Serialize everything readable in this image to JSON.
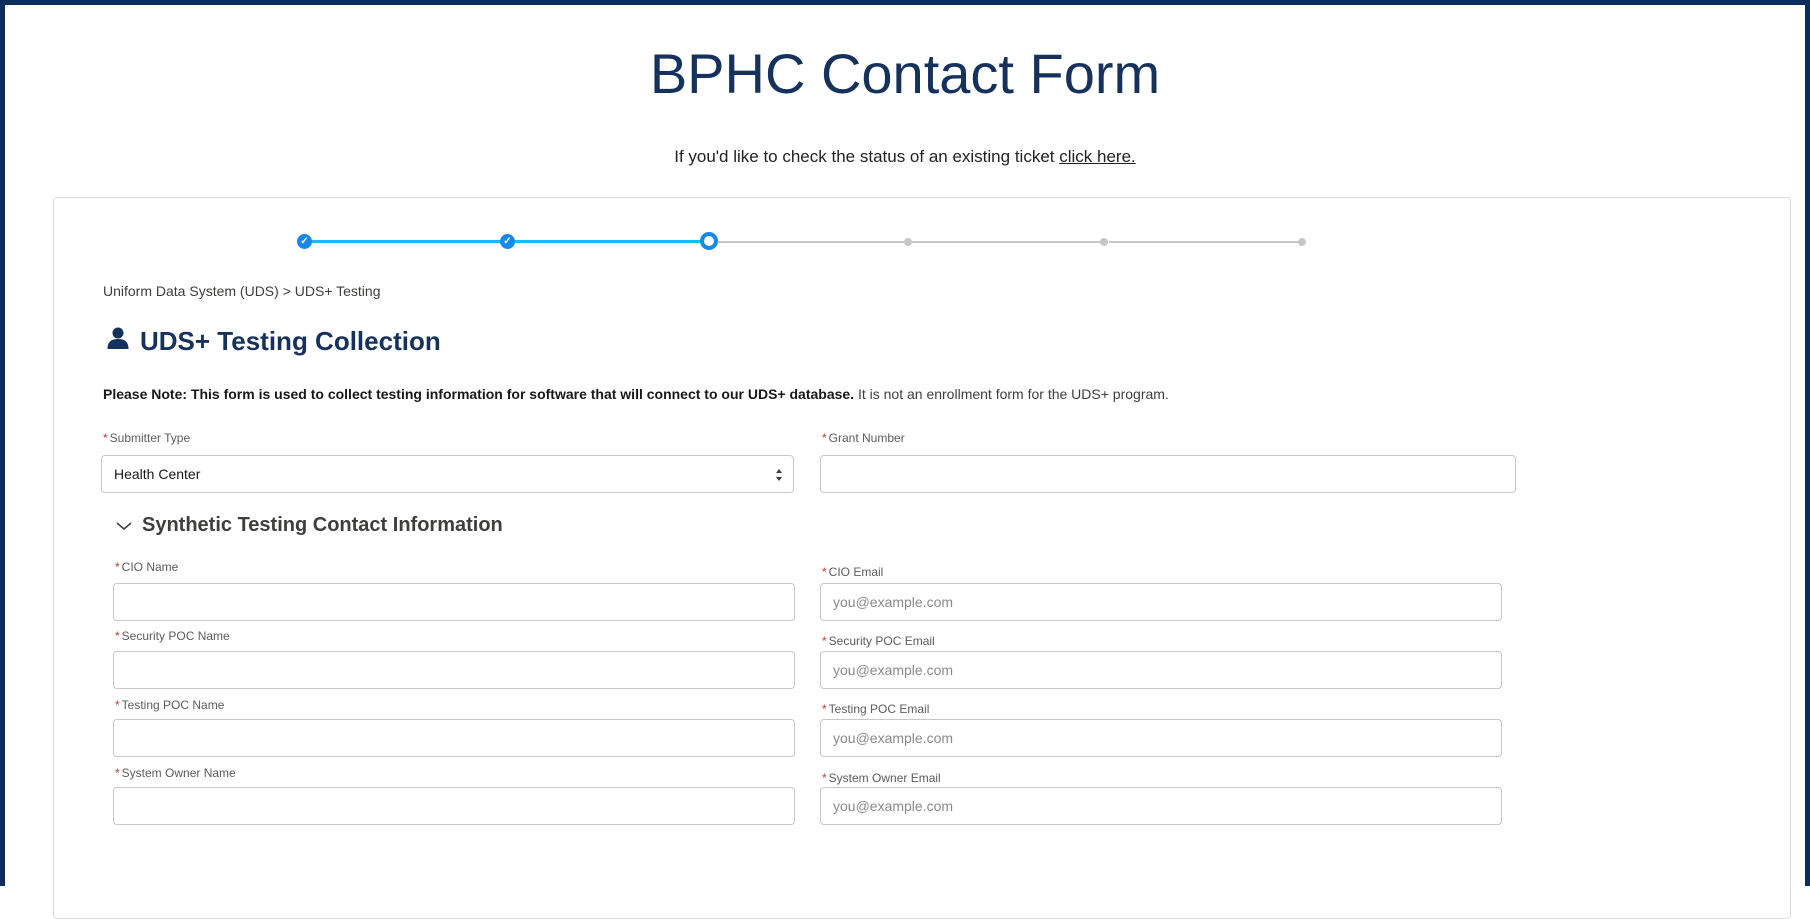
{
  "header": {
    "title": "BPHC Contact Form",
    "status_text": "If you'd like to check the status of an existing ticket",
    "status_link": "click here."
  },
  "progress": {
    "total_steps": 6,
    "completed_steps": 2,
    "current_step": 3
  },
  "breadcrumb": "Uniform Data System (UDS) > UDS+ Testing",
  "section": {
    "title": "UDS+ Testing Collection",
    "icon": "user-icon"
  },
  "note": {
    "bold": "Please Note: This form is used to collect testing information for software that will connect to our UDS+ database.",
    "rest": " It is not an enrollment form for the UDS+ program."
  },
  "fields": {
    "submitter_type": {
      "label": "Submitter Type",
      "value": "Health Center"
    },
    "grant_number": {
      "label": "Grant Number",
      "value": ""
    }
  },
  "group": {
    "title": "Synthetic Testing Contact Information",
    "icon": "chevron-down-icon"
  },
  "contacts": {
    "cio_name": {
      "label": "CIO Name",
      "value": ""
    },
    "cio_email": {
      "label": "CIO Email",
      "placeholder": "you@example.com"
    },
    "security_name": {
      "label": "Security POC Name",
      "value": ""
    },
    "security_email": {
      "label": "Security POC Email",
      "placeholder": "you@example.com"
    },
    "testing_name": {
      "label": "Testing POC Name",
      "value": ""
    },
    "testing_email": {
      "label": "Testing POC Email",
      "placeholder": "you@example.com"
    },
    "owner_name": {
      "label": "System Owner Name",
      "value": ""
    },
    "owner_email": {
      "label": "System Owner Email",
      "placeholder": "you@example.com"
    }
  },
  "colors": {
    "frame": "#0b2d5b",
    "title": "#16325c",
    "progress_done": "#1ab9ff",
    "step_done": "#1589ee",
    "required": "#c23934"
  }
}
